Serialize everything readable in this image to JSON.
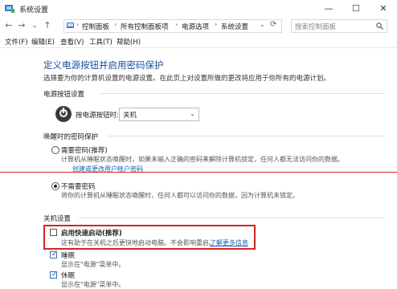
{
  "window": {
    "title": "系统设置",
    "minimize": "—",
    "maximize": "☐",
    "close": "✕"
  },
  "nav": {
    "back": "←",
    "forward": "→",
    "dropdown": "⌄",
    "up": "↑"
  },
  "breadcrumb": [
    "控制面板",
    "所有控制面板项",
    "电源选项",
    "系统设置"
  ],
  "search": {
    "placeholder": "搜索控制面板"
  },
  "menu": [
    "文件(F)",
    "编辑(E)",
    "查看(V)",
    "工具(T)",
    "帮助(H)"
  ],
  "page": {
    "heading": "定义电源按钮并启用密码保护",
    "description": "选择要为你的计算机设置的电源设置。在此页上对设置所做的更改将应用于你所有的电源计划。"
  },
  "power_section": {
    "title": "电源按钮设置",
    "button_label": "按电源按钮时:",
    "selected_option": "关机"
  },
  "wake_section": {
    "title": "唤醒时的密码保护",
    "require": {
      "label": "需要密码(推荐)",
      "desc": "计算机从睡眠状态唤醒时，如果未输入正确的密码来解除计算机锁定，任何人都无法访问你的数",
      "desc2": "据。",
      "link": "创建或更改用户帐户密码"
    },
    "no_require": {
      "label": "不需要密码",
      "desc": "将你的计算机从睡眠状态唤醒时，任何人都可以访问你的数据，因为计算机未锁定。"
    }
  },
  "shutdown_section": {
    "title": "关机设置",
    "fast_startup": {
      "label": "启用快速启动(推荐)",
      "desc": "这有助于在关机之后更快地启动电脑。不会影响重启。",
      "link": "了解更多信息"
    },
    "sleep": {
      "label": "睡眠",
      "desc": "显示在\"电源\"菜单中。"
    },
    "hibernate": {
      "label": "休眠",
      "desc": "显示在\"电源\"菜单中。"
    }
  },
  "colors": {
    "heading": "#1c4f9c",
    "link": "#1a5fb4",
    "highlight": "#d32424"
  }
}
